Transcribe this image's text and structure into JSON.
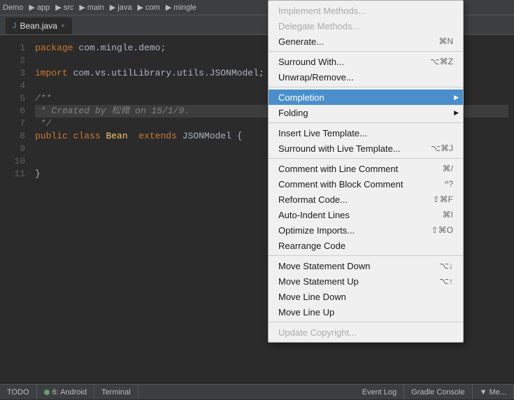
{
  "toolbar": {
    "app_label": "app"
  },
  "tabs": [
    {
      "label": "Bean.java",
      "active": true,
      "icon": "java-file-icon"
    }
  ],
  "code": {
    "lines": [
      {
        "num": 1,
        "text": "package com.mingle.demo;",
        "classes": "plain"
      },
      {
        "num": 2,
        "text": "",
        "classes": "plain"
      },
      {
        "num": 3,
        "text": "import com.vs.utilLibrary.utils.JSONModel;",
        "classes": "plain"
      },
      {
        "num": 4,
        "text": "",
        "classes": "plain"
      },
      {
        "num": 5,
        "text": "/**",
        "classes": "comment"
      },
      {
        "num": 6,
        "text": " * Created by 松微 on 15/1/9.",
        "classes": "comment"
      },
      {
        "num": 7,
        "text": " */",
        "classes": "comment"
      },
      {
        "num": 8,
        "text": "public class Bean  extends JSONModel {",
        "classes": "plain"
      },
      {
        "num": 9,
        "text": "",
        "classes": "plain"
      },
      {
        "num": 10,
        "text": "",
        "classes": "plain"
      },
      {
        "num": 11,
        "text": "}",
        "classes": "plain"
      }
    ]
  },
  "context_menu": {
    "items": [
      {
        "id": "implement-methods",
        "label": "Implement Methods...",
        "shortcut": "",
        "disabled": true,
        "separator_after": false
      },
      {
        "id": "delegate-methods",
        "label": "Delegate Methods...",
        "shortcut": "",
        "disabled": true,
        "separator_after": false
      },
      {
        "id": "generate",
        "label": "Generate...",
        "shortcut": "⌘N",
        "disabled": false,
        "separator_after": true
      },
      {
        "id": "surround-with",
        "label": "Surround With...",
        "shortcut": "⌥⌘Z",
        "disabled": false,
        "separator_after": false
      },
      {
        "id": "unwrap-remove",
        "label": "Unwrap/Remove...",
        "shortcut": "",
        "disabled": false,
        "separator_after": true
      },
      {
        "id": "completion",
        "label": "Completion",
        "shortcut": "",
        "disabled": false,
        "has_submenu": true,
        "separator_after": false,
        "highlighted": true
      },
      {
        "id": "folding",
        "label": "Folding",
        "shortcut": "",
        "disabled": false,
        "has_submenu": true,
        "separator_after": true
      },
      {
        "id": "insert-live-template",
        "label": "Insert Live Template...",
        "shortcut": "",
        "disabled": false,
        "separator_after": false
      },
      {
        "id": "surround-live-template",
        "label": "Surround with Live Template...",
        "shortcut": "⌥⌘J",
        "disabled": false,
        "separator_after": true
      },
      {
        "id": "comment-line",
        "label": "Comment with Line Comment",
        "shortcut": "⌘/",
        "disabled": false,
        "separator_after": false
      },
      {
        "id": "comment-block",
        "label": "Comment with Block Comment",
        "shortcut": "^?",
        "disabled": false,
        "separator_after": false
      },
      {
        "id": "reformat-code",
        "label": "Reformat Code...",
        "shortcut": "⇧⌘F",
        "disabled": false,
        "separator_after": false
      },
      {
        "id": "auto-indent",
        "label": "Auto-Indent Lines",
        "shortcut": "⌘I",
        "disabled": false,
        "separator_after": false
      },
      {
        "id": "optimize-imports",
        "label": "Optimize Imports...",
        "shortcut": "⇧⌘O",
        "disabled": false,
        "separator_after": false
      },
      {
        "id": "rearrange-code",
        "label": "Rearrange Code",
        "shortcut": "",
        "disabled": false,
        "separator_after": true
      },
      {
        "id": "move-statement-down",
        "label": "Move Statement Down",
        "shortcut": "⌥↓",
        "disabled": false,
        "separator_after": false
      },
      {
        "id": "move-statement-up",
        "label": "Move Statement Up",
        "shortcut": "⌥↑",
        "disabled": false,
        "separator_after": false
      },
      {
        "id": "move-line-down",
        "label": "Move Line Down",
        "shortcut": "",
        "disabled": false,
        "separator_after": false
      },
      {
        "id": "move-line-up",
        "label": "Move Line Up",
        "shortcut": "",
        "disabled": false,
        "separator_after": true
      },
      {
        "id": "update-copyright",
        "label": "Update Copyright...",
        "shortcut": "",
        "disabled": true,
        "separator_after": false
      }
    ]
  },
  "status_bar": {
    "items": [
      {
        "id": "todo",
        "label": "TODO"
      },
      {
        "id": "android",
        "label": "6: Android"
      },
      {
        "id": "terminal",
        "label": "Terminal"
      },
      {
        "id": "event-log",
        "label": "Event Log"
      },
      {
        "id": "gradle-console",
        "label": "Gradle Console"
      },
      {
        "id": "maven",
        "label": "▼ Me..."
      }
    ]
  }
}
